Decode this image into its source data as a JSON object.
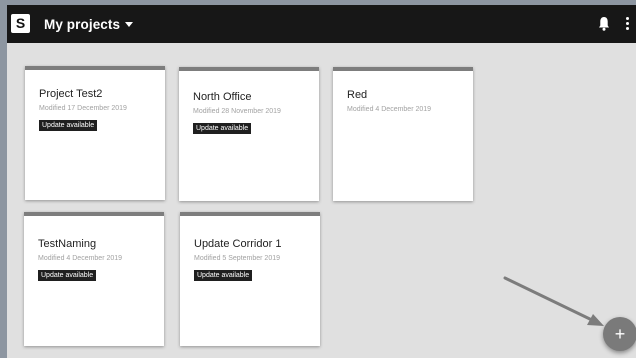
{
  "header": {
    "logo": "S",
    "title": "My projects",
    "icons": [
      "chevron-down-icon",
      "bell-icon",
      "more-vert-icon"
    ]
  },
  "projects": [
    {
      "name": "Project Test2",
      "modified": "Modified 17 December 2019",
      "badge": "Update available"
    },
    {
      "name": "North Office",
      "modified": "Modified 28 November 2019",
      "badge": "Update available"
    },
    {
      "name": "Red",
      "modified": "Modified 4 December 2019",
      "badge": ""
    },
    {
      "name": "TestNaming",
      "modified": "Modified 4 December 2019",
      "badge": "Update available"
    },
    {
      "name": "Update Corridor 1",
      "modified": "Modified 5 September 2019",
      "badge": "Update available"
    }
  ],
  "fab": {
    "label": "+",
    "icon": "plus-icon"
  },
  "colors": {
    "topbar": "#171717",
    "background": "#e0e0e0",
    "card_bar": "#7d7d7d",
    "badge": "#1f1f1f",
    "fab": "#7a7a7a"
  }
}
